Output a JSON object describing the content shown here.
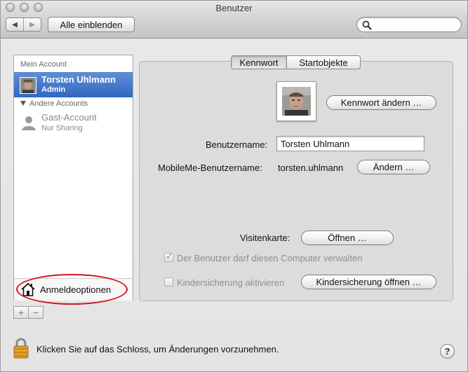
{
  "window": {
    "title": "Benutzer"
  },
  "toolbar": {
    "back_glyph": "◀",
    "forward_glyph": "▶",
    "show_all_label": "Alle einblenden",
    "search_placeholder": ""
  },
  "sidebar": {
    "group_my_account": "Mein Account",
    "selected_account": {
      "name": "Torsten Uhlmann",
      "role": "Admin"
    },
    "group_other_accounts": "Andere Accounts",
    "guest_account": {
      "name": "Gast-Account",
      "role": "Nur Sharing"
    },
    "login_options_label": "Anmeldeoptionen",
    "add_glyph": "+",
    "remove_glyph": "−"
  },
  "tabs": [
    {
      "label": "Kennwort",
      "active": true
    },
    {
      "label": "Startobjekte",
      "active": false
    }
  ],
  "form": {
    "change_password_label": "Kennwort ändern …",
    "username_label": "Benutzername:",
    "username_value": "Torsten Uhlmann",
    "mobileme_label": "MobileMe-Benutzername:",
    "mobileme_value": "torsten.uhlmann",
    "mobileme_change_label": "Ändern …",
    "vcard_label": "Visitenkarte:",
    "vcard_open_label": "Öffnen …",
    "admin_checkbox_label": "Der Benutzer darf diesen Computer verwalten",
    "admin_checked": true,
    "parental_checkbox_label": "Kindersicherung aktivieren",
    "parental_checked": false,
    "parental_open_label": "Kindersicherung öffnen …"
  },
  "footer": {
    "lock_text": "Klicken Sie auf das Schloss, um Änderungen vorzunehmen.",
    "help_glyph": "?"
  },
  "colors": {
    "selection": "#2f67c3",
    "annotation_red": "#d0161e"
  }
}
